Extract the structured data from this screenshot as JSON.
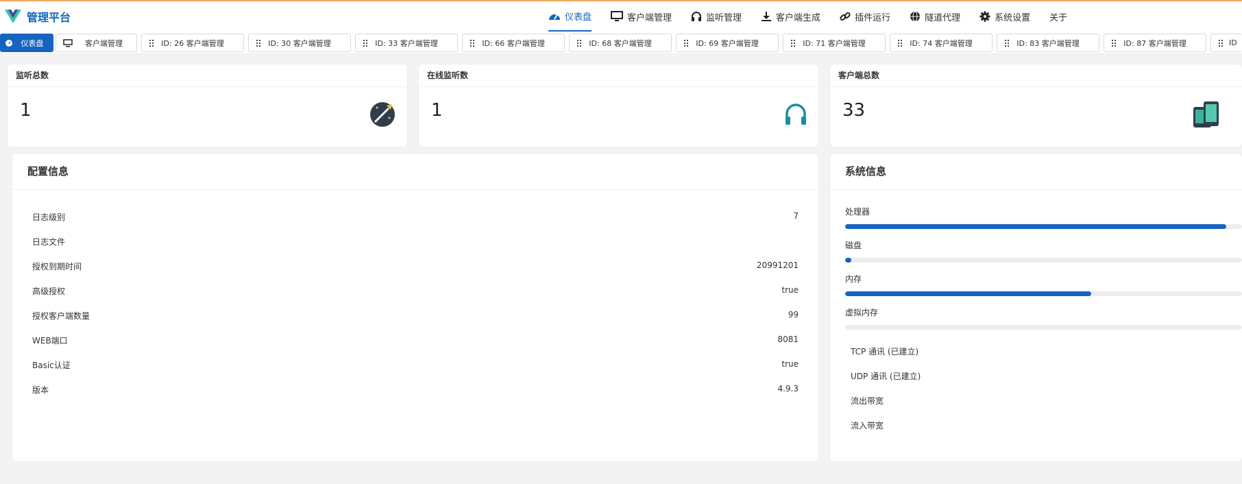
{
  "app": {
    "title": "管理平台"
  },
  "nav": [
    {
      "label": "仪表盘",
      "icon": "dashboard-icon",
      "active": true
    },
    {
      "label": "客户端管理",
      "icon": "monitor-icon"
    },
    {
      "label": "监听管理",
      "icon": "headphones-icon"
    },
    {
      "label": "客户端生成",
      "icon": "download-icon"
    },
    {
      "label": "插件运行",
      "icon": "link-icon"
    },
    {
      "label": "隧道代理",
      "icon": "globe-icon"
    },
    {
      "label": "系统设置",
      "icon": "gear-icon"
    },
    {
      "label": "关于",
      "icon": ""
    }
  ],
  "tabs": [
    {
      "label": "仪表盘",
      "icon": "dashboard-icon",
      "active": true
    },
    {
      "label": "客户端管理",
      "icon": "monitor-icon"
    },
    {
      "label": "ID: 26 客户端管理",
      "icon": "drag-handle-icon"
    },
    {
      "label": "ID: 30 客户端管理",
      "icon": "drag-handle-icon"
    },
    {
      "label": "ID: 33 客户端管理",
      "icon": "drag-handle-icon"
    },
    {
      "label": "ID: 66 客户端管理",
      "icon": "drag-handle-icon"
    },
    {
      "label": "ID: 68 客户端管理",
      "icon": "drag-handle-icon"
    },
    {
      "label": "ID: 69 客户端管理",
      "icon": "drag-handle-icon"
    },
    {
      "label": "ID: 71 客户端管理",
      "icon": "drag-handle-icon"
    },
    {
      "label": "ID: 74 客户端管理",
      "icon": "drag-handle-icon"
    },
    {
      "label": "ID: 83 客户端管理",
      "icon": "drag-handle-icon"
    },
    {
      "label": "ID: 87 客户端管理",
      "icon": "drag-handle-icon"
    },
    {
      "label": "ID",
      "icon": "drag-handle-icon"
    }
  ],
  "stats": [
    {
      "title": "监听总数",
      "value": "1",
      "icon": "rocket-icon"
    },
    {
      "title": "在线监听数",
      "value": "1",
      "icon": "headphones-icon"
    },
    {
      "title": "客户端总数",
      "value": "33",
      "icon": "devices-icon"
    }
  ],
  "config": {
    "title": "配置信息",
    "rows": [
      {
        "key": "日志级别",
        "value": "7"
      },
      {
        "key": "日志文件",
        "value": ""
      },
      {
        "key": "授权到期时间",
        "value": "20991201"
      },
      {
        "key": "高级授权",
        "value": "true"
      },
      {
        "key": "授权客户端数量",
        "value": "99"
      },
      {
        "key": "WEB端口",
        "value": "8081"
      },
      {
        "key": "Basic认证",
        "value": "true"
      },
      {
        "key": "版本",
        "value": "4.9.3"
      }
    ]
  },
  "system": {
    "title": "系统信息",
    "resources": [
      {
        "label": "处理器",
        "percent": 96
      },
      {
        "label": "磁盘",
        "percent": 2
      },
      {
        "label": "内存",
        "percent": 62
      },
      {
        "label": "虚拟内存",
        "percent": 0
      }
    ],
    "network": [
      {
        "label": "TCP 通讯 (已建立)"
      },
      {
        "label": "UDP 通讯 (已建立)"
      },
      {
        "label": "流出带宽"
      },
      {
        "label": "流入带宽"
      }
    ]
  },
  "colors": {
    "accent": "#1565c0",
    "warning_line": "#f2a860",
    "track": "#ededed"
  }
}
